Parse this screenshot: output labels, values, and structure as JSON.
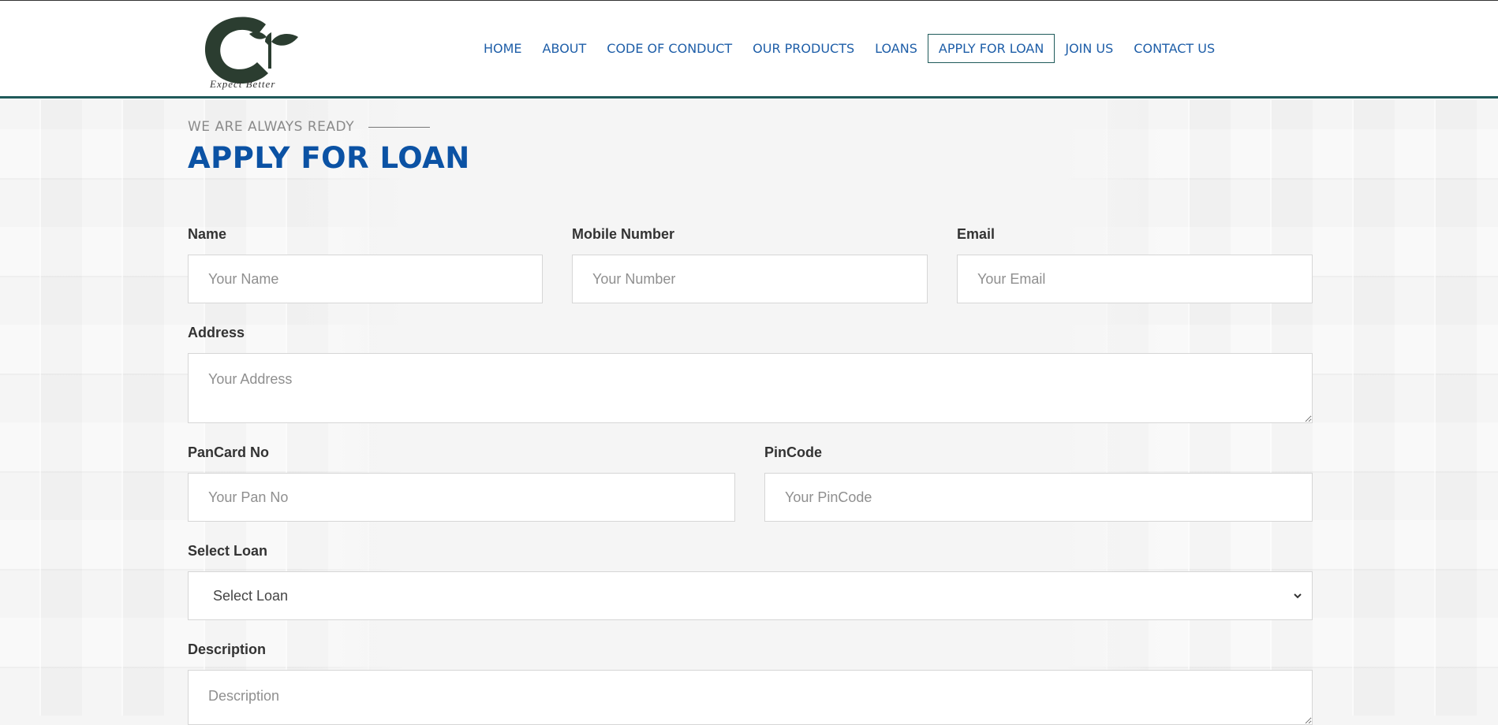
{
  "header": {
    "logo_tagline": "Expect Better",
    "nav": [
      {
        "label": "HOME",
        "active": false
      },
      {
        "label": "ABOUT",
        "active": false
      },
      {
        "label": "CODE OF CONDUCT",
        "active": false
      },
      {
        "label": "OUR PRODUCTS",
        "active": false
      },
      {
        "label": "LOANS",
        "active": false
      },
      {
        "label": "APPLY FOR LOAN",
        "active": true
      },
      {
        "label": "JOIN US",
        "active": false
      },
      {
        "label": "CONTACT US",
        "active": false
      }
    ]
  },
  "section": {
    "eyebrow": "WE ARE ALWAYS READY",
    "title": "APPLY FOR LOAN"
  },
  "form": {
    "name": {
      "label": "Name",
      "placeholder": "Your Name"
    },
    "mobile": {
      "label": "Mobile Number",
      "placeholder": "Your Number"
    },
    "email": {
      "label": "Email",
      "placeholder": "Your Email"
    },
    "address": {
      "label": "Address",
      "placeholder": "Your Address"
    },
    "pancard": {
      "label": "PanCard No",
      "placeholder": "Your Pan No"
    },
    "pincode": {
      "label": "PinCode",
      "placeholder": "Your PinCode"
    },
    "loan": {
      "label": "Select Loan",
      "selected": "Select Loan"
    },
    "description": {
      "label": "Description",
      "placeholder": "Description"
    }
  },
  "colors": {
    "nav_text": "#1e5ea8",
    "title": "#0b52a4",
    "logo_green": "#2b3d30",
    "header_border": "#1f5a5a"
  }
}
